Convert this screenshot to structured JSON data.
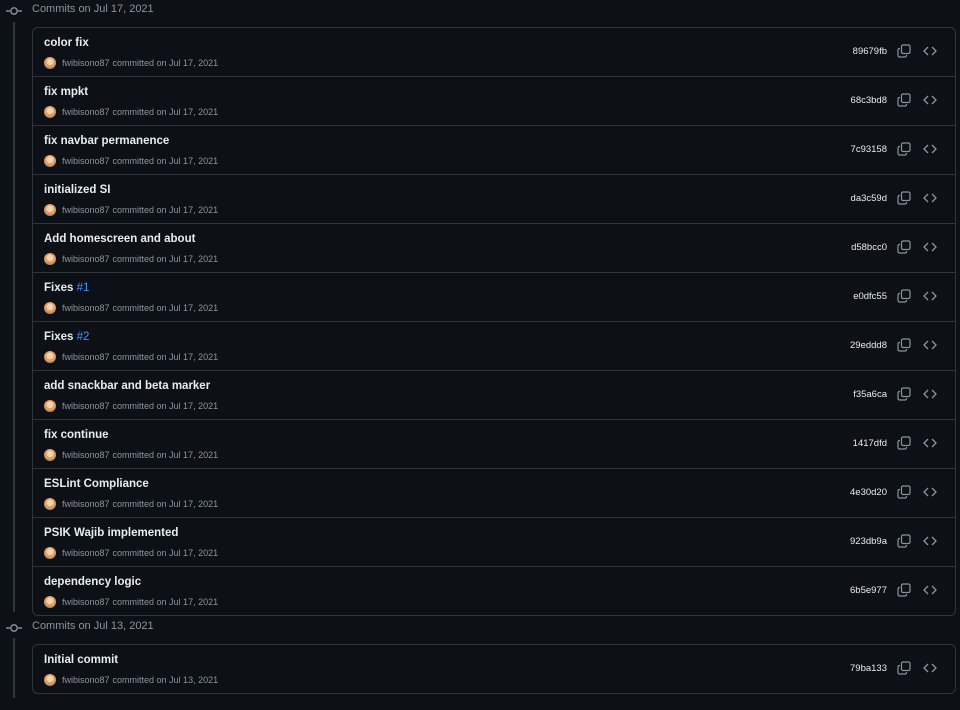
{
  "groups": [
    {
      "title": "Commits on Jul 17, 2021",
      "commits": [
        {
          "message": "color fix",
          "issue": "",
          "author": "fwibisono87",
          "meta": "committed on Jul 17, 2021",
          "sha": "89679fb"
        },
        {
          "message": "fix mpkt",
          "issue": "",
          "author": "fwibisono87",
          "meta": "committed on Jul 17, 2021",
          "sha": "68c3bd8"
        },
        {
          "message": "fix navbar permanence",
          "issue": "",
          "author": "fwibisono87",
          "meta": "committed on Jul 17, 2021",
          "sha": "7c93158"
        },
        {
          "message": "initialized SI",
          "issue": "",
          "author": "fwibisono87",
          "meta": "committed on Jul 17, 2021",
          "sha": "da3c59d"
        },
        {
          "message": "Add homescreen and about",
          "issue": "",
          "author": "fwibisono87",
          "meta": "committed on Jul 17, 2021",
          "sha": "d58bcc0"
        },
        {
          "message": "Fixes ",
          "issue": "#1",
          "author": "fwibisono87",
          "meta": "committed on Jul 17, 2021",
          "sha": "e0dfc55"
        },
        {
          "message": "Fixes ",
          "issue": "#2",
          "author": "fwibisono87",
          "meta": "committed on Jul 17, 2021",
          "sha": "29eddd8"
        },
        {
          "message": "add snackbar and beta marker",
          "issue": "",
          "author": "fwibisono87",
          "meta": "committed on Jul 17, 2021",
          "sha": "f35a6ca"
        },
        {
          "message": "fix continue",
          "issue": "",
          "author": "fwibisono87",
          "meta": "committed on Jul 17, 2021",
          "sha": "1417dfd"
        },
        {
          "message": "ESLint Compliance",
          "issue": "",
          "author": "fwibisono87",
          "meta": "committed on Jul 17, 2021",
          "sha": "4e30d20"
        },
        {
          "message": "PSIK Wajib implemented",
          "issue": "",
          "author": "fwibisono87",
          "meta": "committed on Jul 17, 2021",
          "sha": "923db9a"
        },
        {
          "message": "dependency logic",
          "issue": "",
          "author": "fwibisono87",
          "meta": "committed on Jul 17, 2021",
          "sha": "6b5e977"
        }
      ]
    },
    {
      "title": "Commits on Jul 13, 2021",
      "commits": [
        {
          "message": "Initial commit",
          "issue": "",
          "author": "fwibisono87",
          "meta": "committed on Jul 13, 2021",
          "sha": "79ba133"
        }
      ]
    }
  ],
  "icons": {
    "commit_node": "git-commit-icon",
    "copy": "copy-icon",
    "browse": "code-icon",
    "avatar": "avatar"
  },
  "colors": {
    "background": "#0d1117",
    "border": "#30363d",
    "text": "#e6edf3",
    "muted": "#8b949e",
    "link": "#4493f8"
  }
}
